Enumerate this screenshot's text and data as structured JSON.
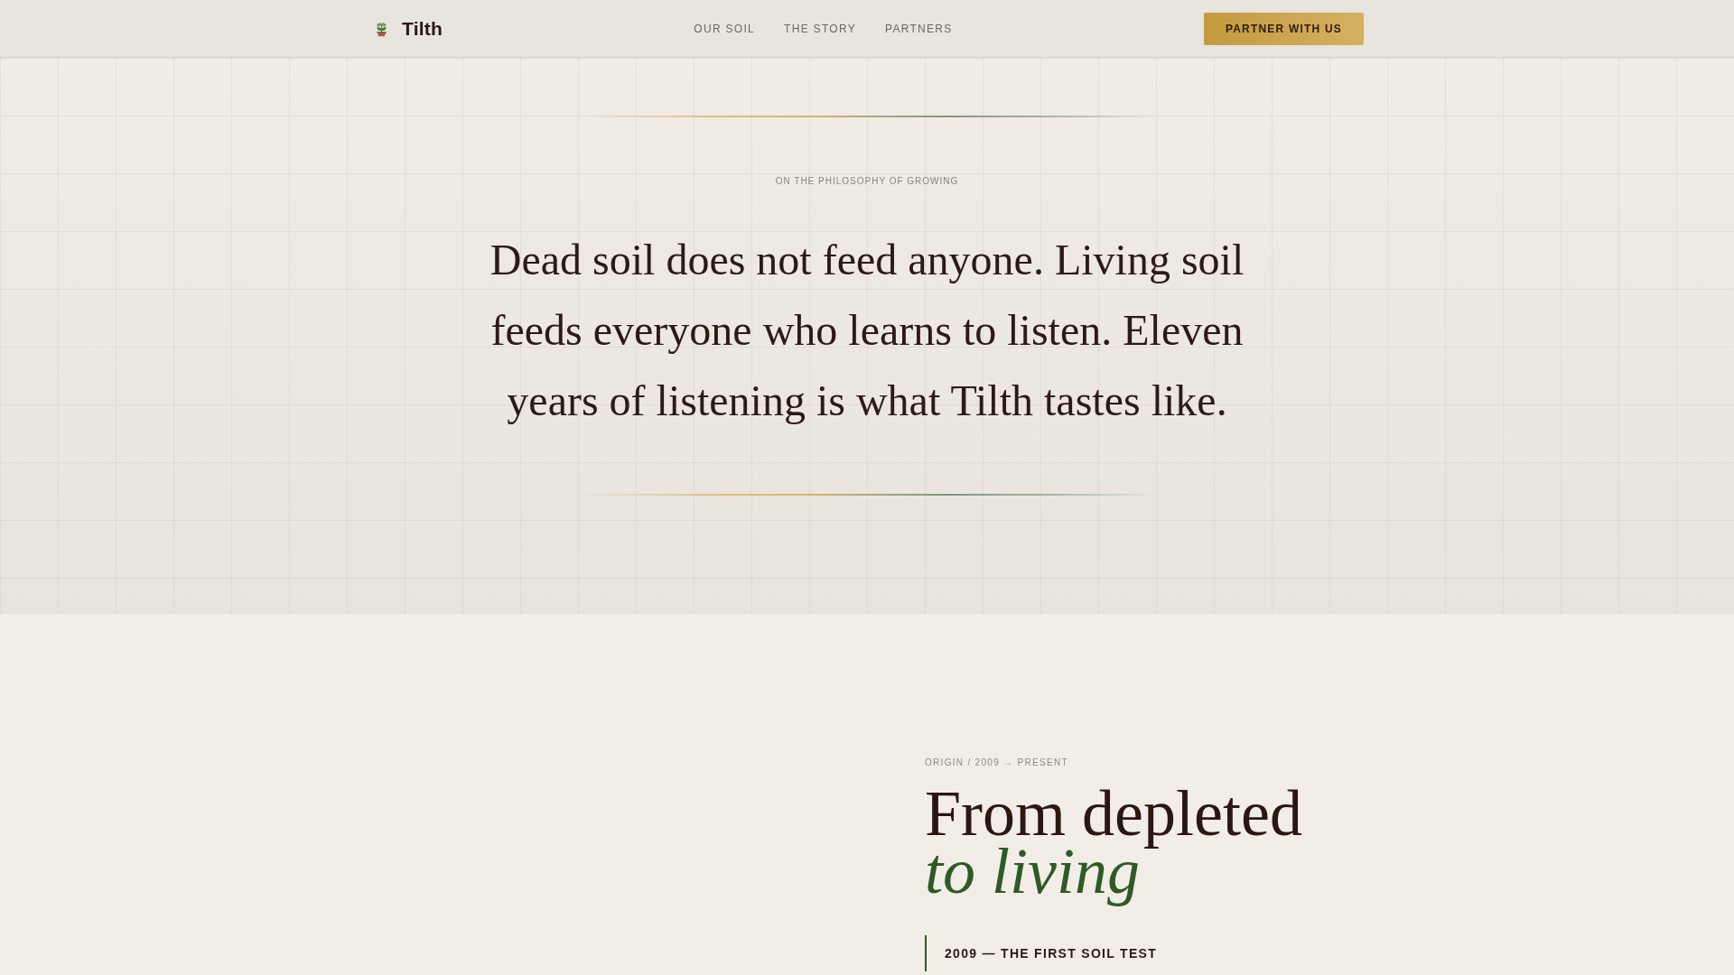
{
  "header": {
    "brand": "Tilth",
    "nav": [
      {
        "label": "OUR SOIL"
      },
      {
        "label": "THE STORY"
      },
      {
        "label": "PARTNERS"
      }
    ],
    "cta_button": "PARTNER WITH US"
  },
  "hero": {
    "eyebrow": "ON THE PHILOSOPHY OF GROWING",
    "quote": "Dead soil does not feed anyone. Living soil feeds everyone who learns to listen. Eleven years of listening is what Tilth tastes like."
  },
  "origin": {
    "eyebrow": "ORIGIN / 2009 → PRESENT",
    "heading": "From depleted",
    "heading_accent": "to living",
    "milestones": [
      {
        "title": "2009 — THE FIRST SOIL TEST"
      }
    ]
  }
}
